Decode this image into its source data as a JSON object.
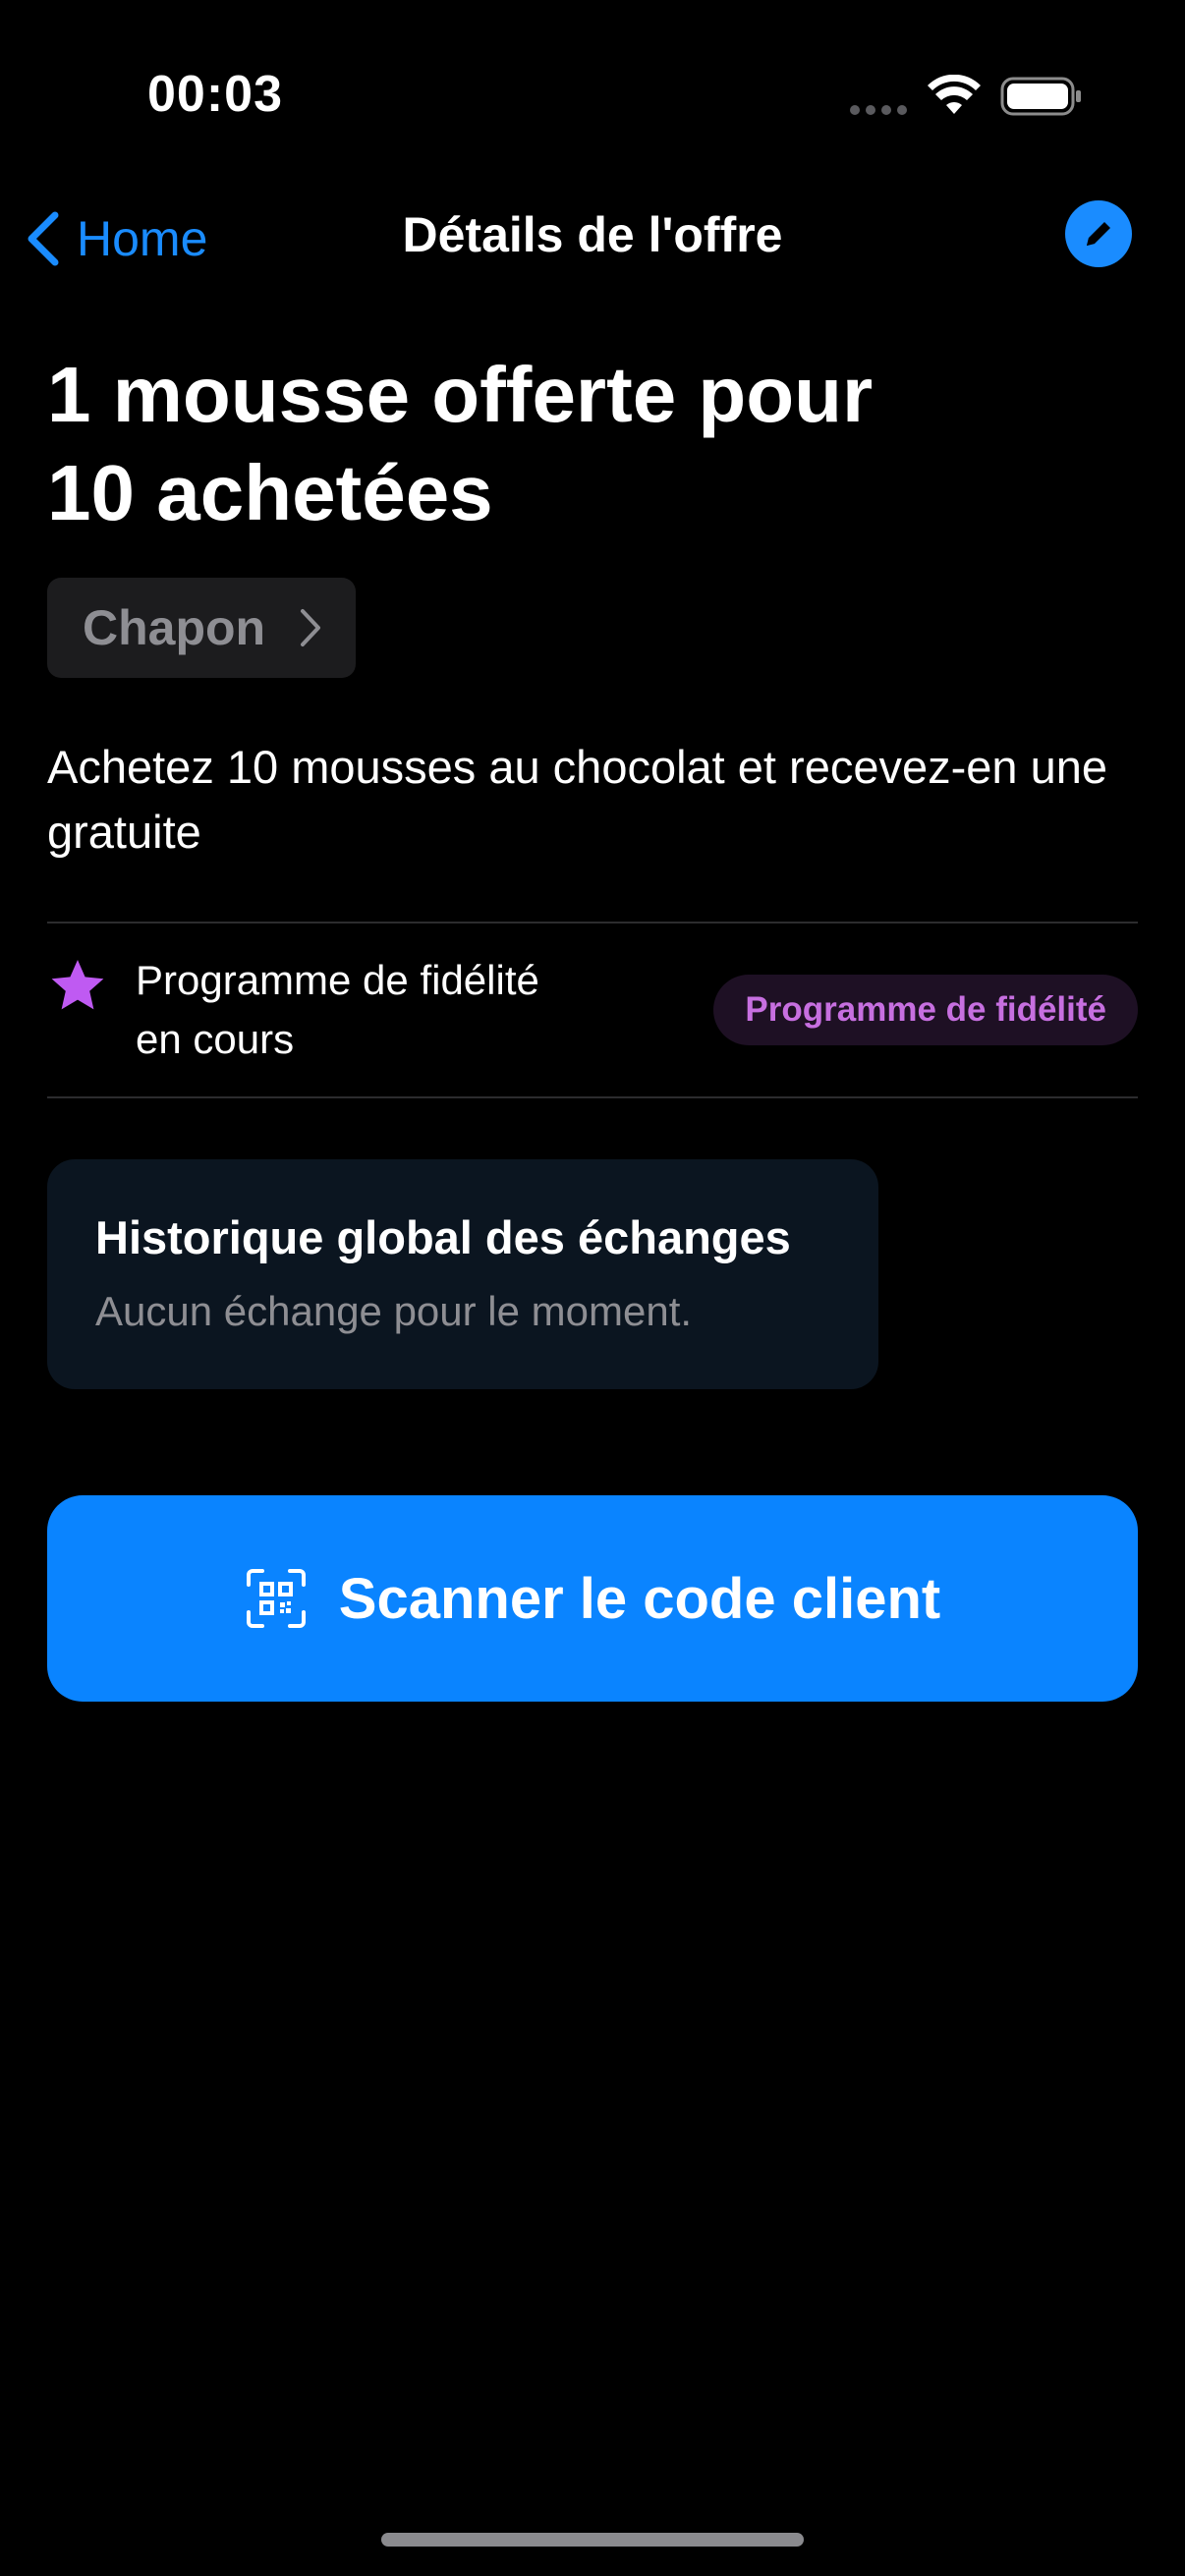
{
  "status_bar": {
    "time": "00:03"
  },
  "nav": {
    "back_label": "Home",
    "title": "Détails de l'offre",
    "edit_icon": "pencil-icon"
  },
  "offer": {
    "title_line1": "1 mousse offerte pour",
    "title_line2": "10 achetées",
    "merchant": "Chapon",
    "description": "Achetez 10 mousses au chocolat et recevez-en une gratuite"
  },
  "status_row": {
    "icon": "star-icon",
    "text_line1": "Programme de fidélité",
    "text_line2": "en cours",
    "badge": "Programme de fidélité"
  },
  "history": {
    "title": "Historique global des échanges",
    "empty_text": "Aucun échange pour le moment."
  },
  "scan_button": {
    "label": "Scanner le code client",
    "icon": "qr-code-icon"
  },
  "colors": {
    "accent": "#0a84ff",
    "badge_text": "#c76fe0",
    "star": "#bf5af2",
    "background": "#000000"
  }
}
